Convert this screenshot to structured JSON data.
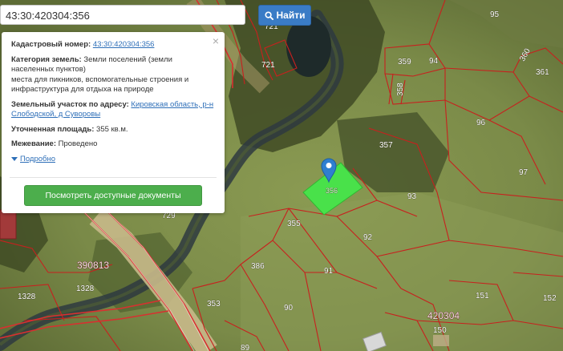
{
  "search": {
    "value": "43:30:420304:356",
    "button_label": "Найти",
    "button_icon": "search-icon"
  },
  "popup": {
    "close_glyph": "×",
    "cadastral_label": "Кадастровый номер:",
    "cadastral_value": "43:30:420304:356",
    "category_label": "Категория земель:",
    "category_value": "Земли поселений (земли населенных пунктов)",
    "category_extra": "места для пикников, вспомогательные строения и инфраструктура для отдыха на природе",
    "address_label": "Земельный участок по адресу:",
    "address_value": "Кировская область, р-н Слободской, д Суворовы",
    "area_label": "Уточненная площадь:",
    "area_value": "355 кв.м.",
    "survey_label": "Межевание:",
    "survey_value": "Проведено",
    "more_label": "Подробно",
    "docs_button": "Посмотреть доступные документы"
  },
  "map": {
    "plot_numbers": [
      "721",
      "721",
      "359",
      "94",
      "95",
      "360",
      "361",
      "358",
      "96",
      "357",
      "97",
      "93",
      "355",
      "92",
      "386",
      "91",
      "353",
      "90",
      "151",
      "152",
      "150",
      "89",
      "1328",
      "1328",
      "729",
      "356"
    ],
    "block_numbers": [
      "390813",
      "420304"
    ],
    "selected_plot": "356",
    "colors": {
      "boundary": "#c8201e",
      "selected": "#44e84a",
      "marker": "#2f7fd0"
    }
  }
}
